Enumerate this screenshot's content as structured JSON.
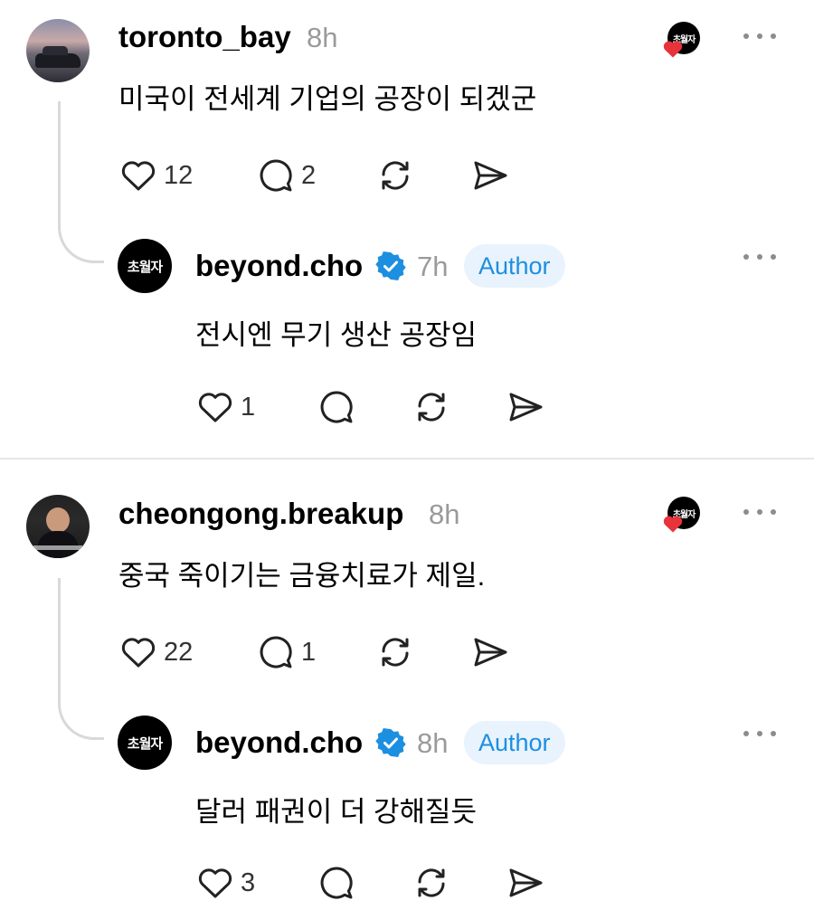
{
  "threads": [
    {
      "comment": {
        "username": "toronto_bay",
        "time": "8h",
        "text": "미국이 전세계 기업의 공장이 되겠군",
        "likes": "12",
        "replies": "2"
      },
      "liked_by_author_logo": "초월자",
      "reply": {
        "avatar_text": "초월자",
        "username": "beyond.cho",
        "time": "7h",
        "badge": "Author",
        "text": "전시엔 무기 생산 공장임",
        "likes": "1"
      }
    },
    {
      "comment": {
        "username": "cheongong.breakup",
        "time": "8h",
        "text": "중국 죽이기는 금융치료가 제일.",
        "likes": "22",
        "replies": "1"
      },
      "liked_by_author_logo": "초월자",
      "reply": {
        "avatar_text": "초월자",
        "username": "beyond.cho",
        "time": "8h",
        "badge": "Author",
        "text": "달러 패권이 더 강해질듯",
        "likes": "3"
      }
    }
  ],
  "colors": {
    "verified": "#1d8fe0",
    "heart": "#e8333a",
    "author_badge_bg": "#e8f3fd"
  }
}
